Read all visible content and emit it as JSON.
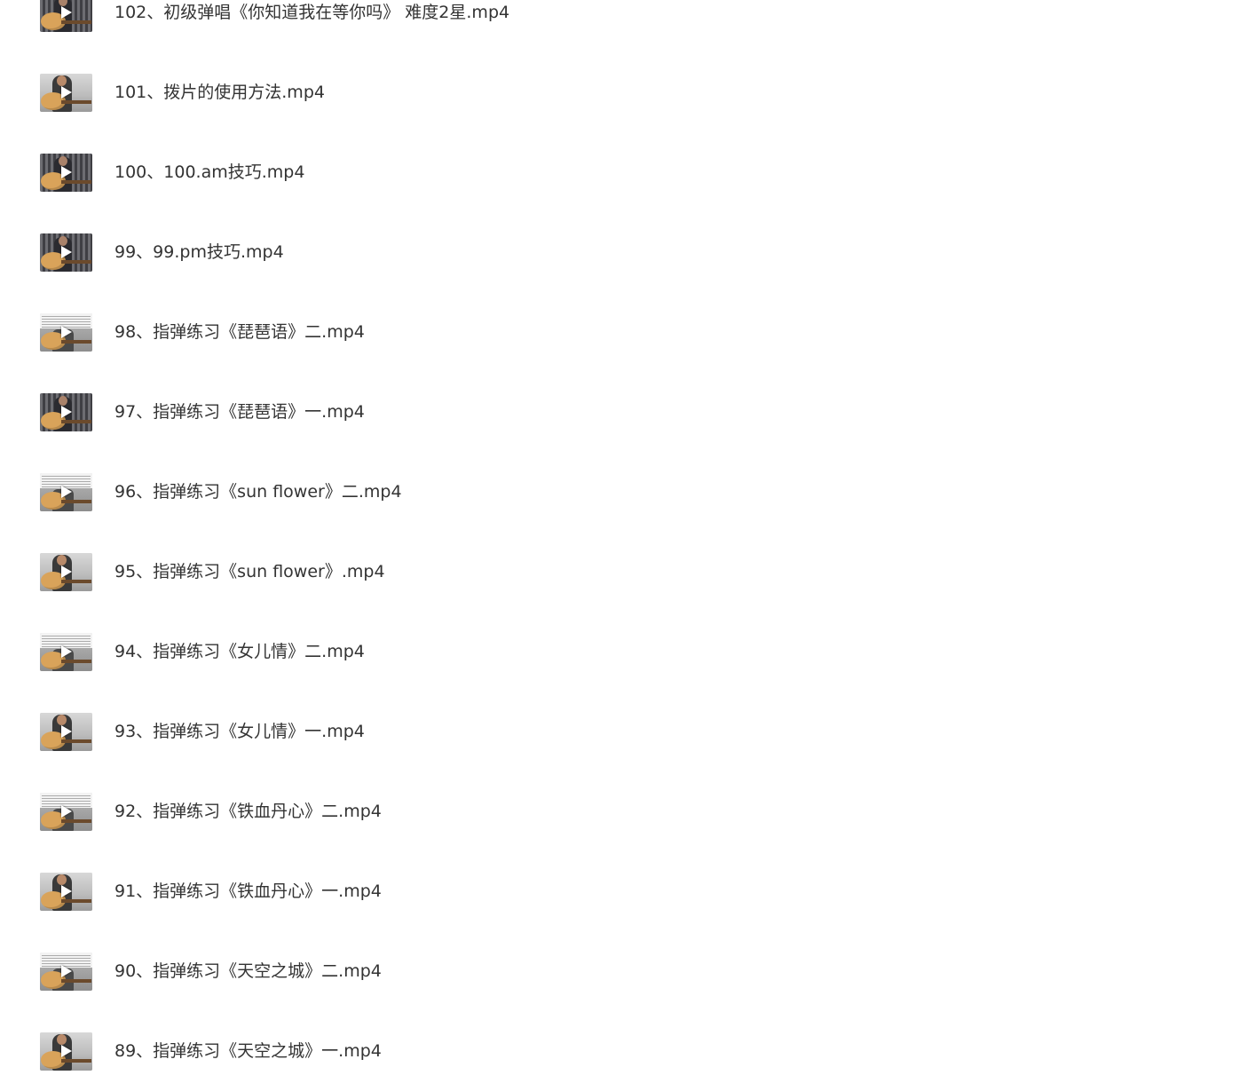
{
  "files": [
    {
      "name": "102、初级弹唱《你知道我在等你吗》 难度2星.mp4",
      "thumb": "stripe",
      "icon": "play-icon"
    },
    {
      "name": "101、拨片的使用方法.mp4",
      "thumb": "person",
      "icon": "play-icon"
    },
    {
      "name": "100、100.am技巧.mp4",
      "thumb": "stripe",
      "icon": "play-icon"
    },
    {
      "name": "99、99.pm技巧.mp4",
      "thumb": "stripe",
      "icon": "play-icon"
    },
    {
      "name": "98、指弹练习《琵琶语》二.mp4",
      "thumb": "score",
      "icon": "play-icon"
    },
    {
      "name": "97、指弹练习《琵琶语》一.mp4",
      "thumb": "stripe",
      "icon": "play-icon"
    },
    {
      "name": "96、指弹练习《sun flower》二.mp4",
      "thumb": "score",
      "icon": "play-icon"
    },
    {
      "name": "95、指弹练习《sun flower》.mp4",
      "thumb": "person",
      "icon": "play-icon"
    },
    {
      "name": "94、指弹练习《女儿情》二.mp4",
      "thumb": "score",
      "icon": "play-icon"
    },
    {
      "name": "93、指弹练习《女儿情》一.mp4",
      "thumb": "person",
      "icon": "play-icon"
    },
    {
      "name": "92、指弹练习《铁血丹心》二.mp4",
      "thumb": "score",
      "icon": "play-icon"
    },
    {
      "name": "91、指弹练习《铁血丹心》一.mp4",
      "thumb": "person",
      "icon": "play-icon"
    },
    {
      "name": "90、指弹练习《天空之城》二.mp4",
      "thumb": "score",
      "icon": "play-icon"
    },
    {
      "name": "89、指弹练习《天空之城》一.mp4",
      "thumb": "person",
      "icon": "play-icon"
    }
  ]
}
